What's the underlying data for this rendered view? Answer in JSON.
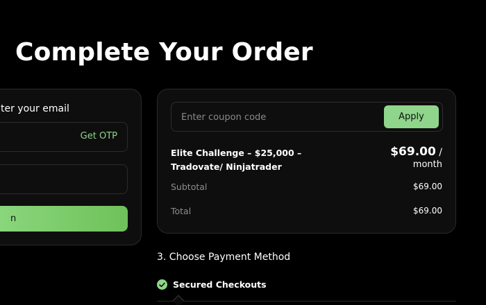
{
  "page": {
    "title": "Complete Your Order"
  },
  "colors": {
    "accent": "#8fd58b",
    "background": "#000000",
    "card": "#0e0e0e"
  },
  "account": {
    "email_label": "ter your email",
    "get_otp_label": "Get OTP",
    "email_value": "",
    "otp_value": "",
    "submit_label": "n"
  },
  "summary": {
    "coupon_placeholder": "Enter coupon code",
    "apply_label": "Apply",
    "product_name": "Elite Challenge – $25,000 – Tradovate/ Ninjatrader",
    "price": "$69.00",
    "price_slash": " /",
    "price_period": "month",
    "subtotal_label": "Subtotal",
    "subtotal_value": "$69.00",
    "total_label": "Total",
    "total_value": "$69.00"
  },
  "payment": {
    "heading": "3. Choose Payment Method",
    "secured_label": "Secured Checkouts",
    "secured_icon": "check-circle-icon"
  }
}
